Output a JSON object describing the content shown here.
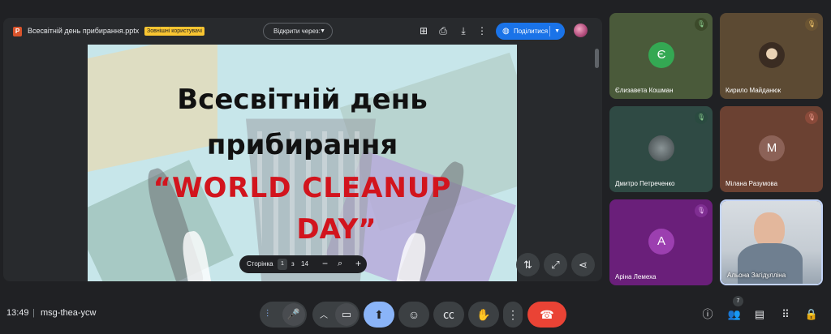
{
  "presentation": {
    "file_name": "Всесвітній день прибирання.pptx",
    "badge": "Зовнішні користувачі",
    "open_with": "Відкрити через",
    "share_label": "Поділитися",
    "slide": {
      "line1": "Всесвітній день",
      "line2": "прибирання",
      "line3": "“WORLD CLEANUP",
      "line4": "DAY”"
    },
    "pager": {
      "label": "Сторінка",
      "current": "1",
      "of": "з",
      "total": "14"
    }
  },
  "participants": [
    {
      "name": "Єлизавета Кошман",
      "initial": "Є",
      "bg": "#4a5a3a",
      "avatar_color": "#34a853",
      "mic": "muted"
    },
    {
      "name": "Кирило Майданюк",
      "initial": "",
      "bg": "#5c4a33",
      "avatar_color": "#3a2c22",
      "mic": "muted"
    },
    {
      "name": "Дмитро Петреченко",
      "initial": "",
      "bg": "#2f4a44",
      "avatar_color": "#5f6b6d",
      "mic": "muted"
    },
    {
      "name": "Мілана Разумова",
      "initial": "М",
      "bg": "#6b4132",
      "avatar_color": "#8c6257",
      "mic": "muted"
    },
    {
      "name": "Аріна Лемеха",
      "initial": "А",
      "bg": "#6a1f7a",
      "avatar_color": "#9c3fb0",
      "mic": "muted"
    },
    {
      "name": "Альона Загідулліна",
      "initial": "",
      "bg": "#b9c4cf",
      "avatar_color": "#7b8ea3",
      "mic": "video"
    }
  ],
  "bottom": {
    "time": "13:49",
    "separator": "|",
    "meeting_code": "msg-thea-ycw",
    "people_count": "7"
  },
  "colors": {
    "accent": "#1a73e8",
    "end_call": "#ea4335",
    "present_active": "#8ab4f8"
  }
}
